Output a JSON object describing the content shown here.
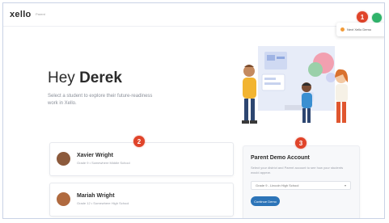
{
  "header": {
    "logo": "xello",
    "logo_sub": "Parent",
    "popover_label": "Next Xello Demo"
  },
  "hero": {
    "greeting": "Hey",
    "name": "Derek",
    "subtitle": "Select a student to explore their future-readiness work in Xello."
  },
  "markers": [
    "1",
    "2",
    "3"
  ],
  "students": [
    {
      "name": "Xavier Wright",
      "school": "Grade 9 • Somewhere Middle School"
    },
    {
      "name": "Mariah Wright",
      "school": "Grade 12 • Somewhere High School"
    }
  ],
  "parent_demo": {
    "title": "Parent Demo Account",
    "description": "Select your district and Parent account to see how your students would appear.",
    "select_value": "Grade 9 - Lincoln High School",
    "button_label": "Continue Demo"
  },
  "colors": {
    "marker": "#e0442a",
    "button": "#2c74b8",
    "avatar": "#2fb36a",
    "popover_dot": "#f29b38"
  }
}
